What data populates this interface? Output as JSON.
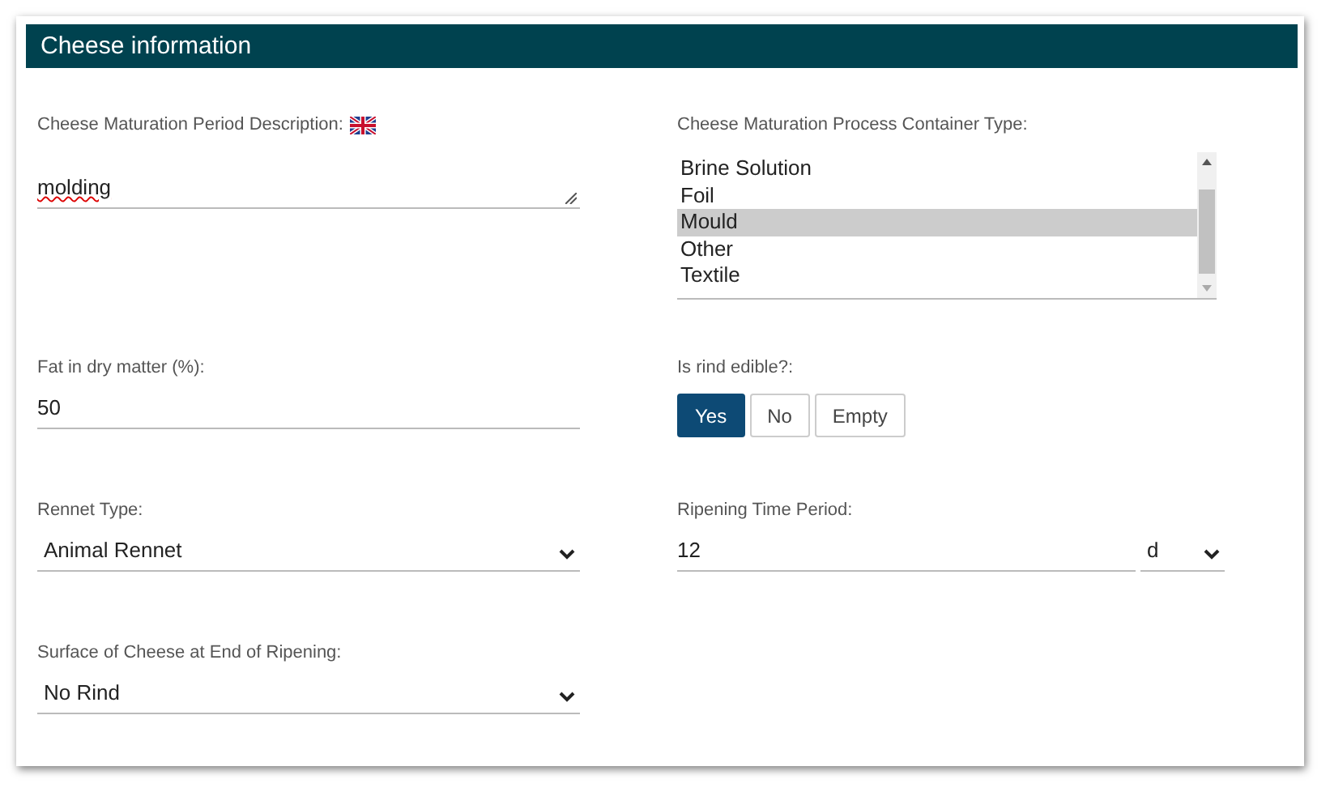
{
  "panel": {
    "title": "Cheese information"
  },
  "fields": [
    {
      "kind": "textarea",
      "label": "Cheese Maturation Period Description:",
      "flag": true,
      "value": "molding",
      "misspelled": true
    },
    {
      "kind": "listbox",
      "label": "Cheese Maturation Process Container Type:",
      "options": [
        {
          "label": "Brine Solution",
          "selected": false
        },
        {
          "label": "Foil",
          "selected": false
        },
        {
          "label": "Mould",
          "selected": true
        },
        {
          "label": "Other",
          "selected": false
        },
        {
          "label": "Textile",
          "selected": false
        }
      ]
    },
    {
      "kind": "text",
      "label": "Fat in dry matter (%):",
      "value": "50"
    },
    {
      "kind": "toggle",
      "label": "Is rind edible?:",
      "options": [
        {
          "label": "Yes",
          "selected": true
        },
        {
          "label": "No",
          "selected": false
        },
        {
          "label": "Empty",
          "selected": false
        }
      ]
    },
    {
      "kind": "select",
      "label": "Rennet Type:",
      "value": "Animal Rennet"
    },
    {
      "kind": "duration",
      "label": "Ripening Time Period:",
      "value": "12",
      "unit": "d"
    },
    {
      "kind": "select",
      "label": "Surface of Cheese at End of Ripening:",
      "value": "No Rind"
    }
  ]
}
